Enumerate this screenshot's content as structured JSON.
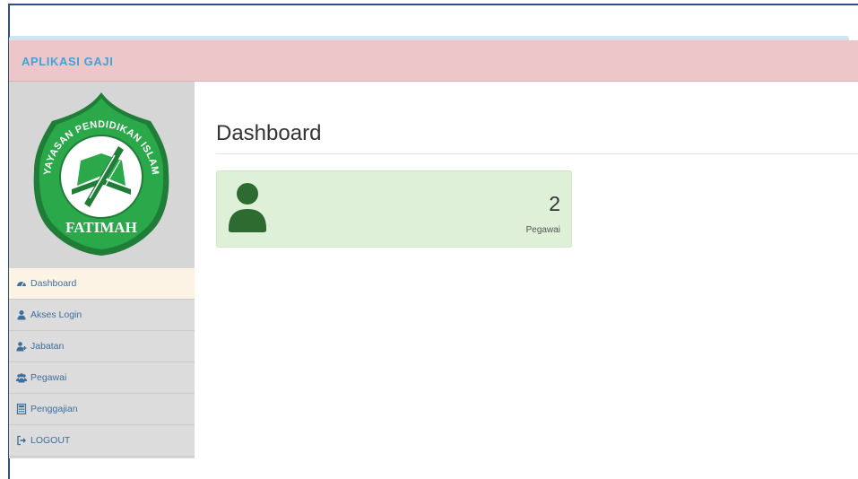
{
  "app": {
    "brand": "APLIKASI GAJI"
  },
  "logo": {
    "arc_text": "YAYASAN PENDIDIKAN ISLAM",
    "name": "FATIMAH",
    "colors": {
      "green": "#2aa84a",
      "ring": "#1f7d37",
      "text": "#ffffff"
    }
  },
  "sidebar": {
    "items": [
      {
        "label": "Dashboard",
        "icon": "dashboard-icon",
        "active": true
      },
      {
        "label": "Akses Login",
        "icon": "user-icon"
      },
      {
        "label": "Jabatan",
        "icon": "user-plus-icon"
      },
      {
        "label": "Pegawai",
        "icon": "users-icon"
      },
      {
        "label": "Penggajian",
        "icon": "calculator-icon"
      },
      {
        "label": "LOGOUT",
        "icon": "sign-out-icon"
      }
    ]
  },
  "main": {
    "title": "Dashboard",
    "stat": {
      "value": "2",
      "label": "Pegawai",
      "icon": "user-icon"
    }
  },
  "colors": {
    "navbar_bg": "#ecc6c8",
    "brand_text": "#3fa3d8",
    "sidebar_bg": "#d6d6d6",
    "active_item_bg": "#fdf3e4",
    "panel_bg": "#dff0d8",
    "panel_icon": "#2e6b30",
    "menu_text": "#3d6e9e"
  }
}
